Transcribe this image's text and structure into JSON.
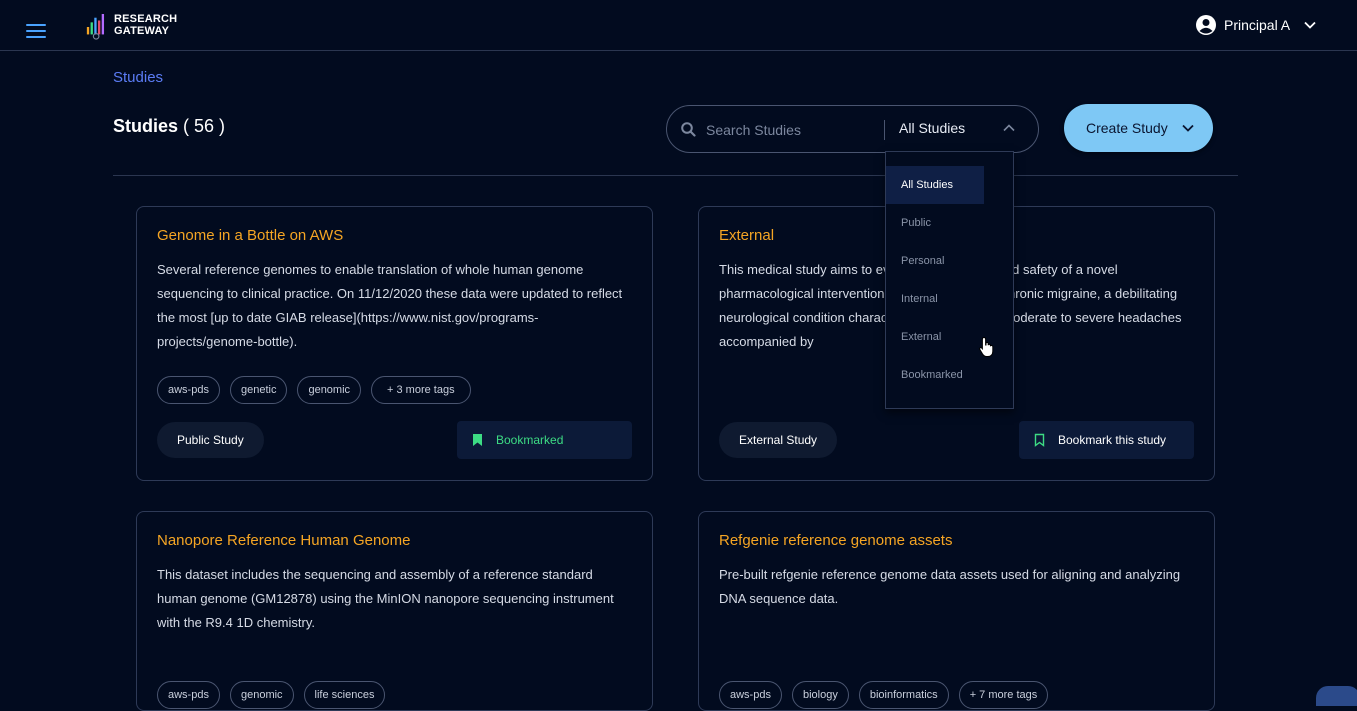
{
  "header": {
    "logo_line1": "RESEARCH",
    "logo_line2": "GATEWAY",
    "user_name": "Principal A"
  },
  "breadcrumb": "Studies",
  "page": {
    "title": "Studies",
    "count": "( 56 )"
  },
  "search": {
    "placeholder": "Search Studies",
    "filter_value": "All Studies"
  },
  "create_button": "Create Study",
  "dropdown": {
    "options": [
      "All Studies",
      "Public",
      "Personal",
      "Internal",
      "External",
      "Bookmarked"
    ],
    "selected": "All Studies"
  },
  "cards": [
    {
      "title": "Genome in a Bottle on AWS",
      "description": "Several reference genomes to enable translation of whole human genome sequencing to clinical practice. On 11/12/2020 these data were updated to reflect the most [up to date GIAB release](https://www.nist.gov/programs-projects/genome-bottle).",
      "tags": [
        "aws-pds",
        "genetic",
        "genomic",
        "+ 3 more tags"
      ],
      "type": "Public Study",
      "bookmark": "Bookmarked"
    },
    {
      "title": "External",
      "description": "This medical study aims to evaluate the efficacy and safety of a novel pharmacological intervention for the treatment of chronic migraine, a debilitating neurological condition characterized by recurring moderate to severe headaches accompanied by",
      "tags": [],
      "type": "External Study",
      "bookmark": "Bookmark this study"
    },
    {
      "title": "Nanopore Reference Human Genome",
      "description": "This dataset includes the sequencing and assembly of a reference standard human genome (GM12878) using the MinION nanopore sequencing instrument with the R9.4 1D chemistry.",
      "tags": [
        "aws-pds",
        "genomic",
        "life sciences"
      ],
      "type": "",
      "bookmark": ""
    },
    {
      "title": "Refgenie reference genome assets",
      "description": "Pre-built refgenie reference genome data assets used for aligning and analyzing DNA sequence data.",
      "tags": [
        "aws-pds",
        "biology",
        "bioinformatics",
        "+ 7 more tags"
      ],
      "type": "",
      "bookmark": ""
    }
  ],
  "colors": {
    "background": "#020b1f",
    "card_title": "#f5a524",
    "accent": "#7ec8f5",
    "bookmarked": "#3ddc84",
    "link": "#5b7cf5"
  }
}
